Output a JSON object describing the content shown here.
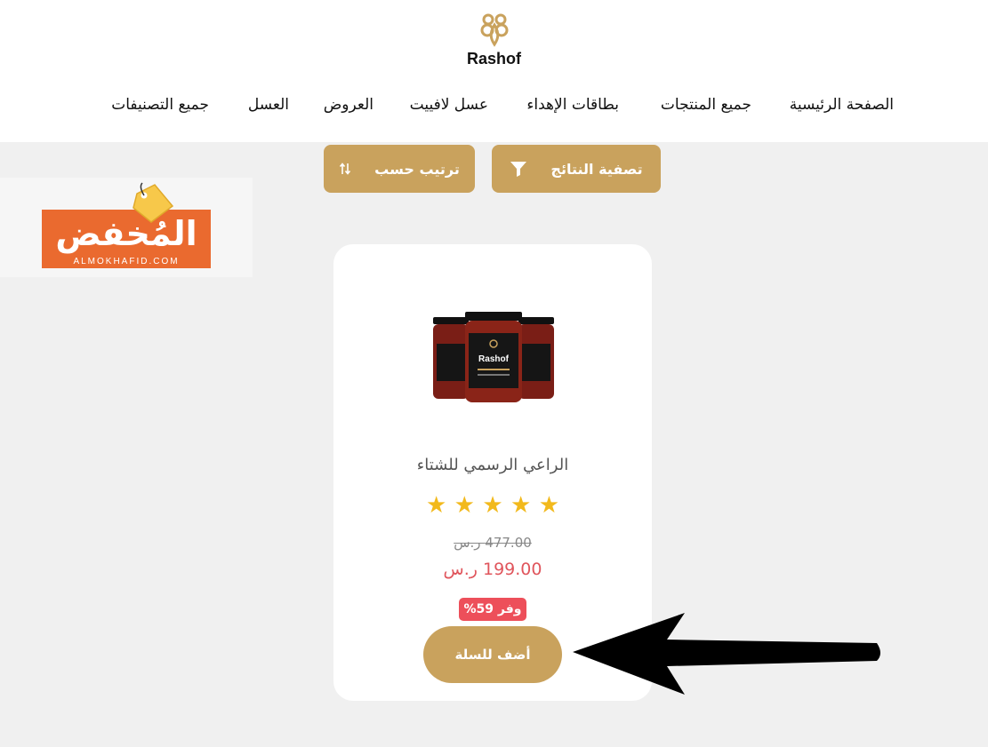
{
  "brand": {
    "name": "Rashof"
  },
  "nav": {
    "items": [
      {
        "label": "الصفحة الرئيسية"
      },
      {
        "label": "جميع المنتجات"
      },
      {
        "label": "بطاقات الإهداء"
      },
      {
        "label": "عسل لافييت"
      },
      {
        "label": "العروض"
      },
      {
        "label": "العسل"
      },
      {
        "label": "جميع التصنيفات"
      }
    ]
  },
  "toolbar": {
    "filter_label": "تصفية النتائج",
    "filter_icon": "filter-icon",
    "sort_label": "ترتيب حسب",
    "sort_icon": "sort-arrows-icon"
  },
  "ad": {
    "title": "المُخفض",
    "subtitle": "ALMOKHAFID.COM",
    "icon": "price-tag-icon"
  },
  "product": {
    "title": "الراعي الرسمي للشتاء",
    "rating": 5,
    "stars": [
      "★",
      "★",
      "★",
      "★",
      "★"
    ],
    "old_price": "477.00 ر.س",
    "new_price": "199.00 ر.س",
    "discount_badge": "وفر 59%",
    "add_to_cart_label": "أضف للسلة",
    "jar_label": "Rashof"
  },
  "colors": {
    "accent": "#c9a25d",
    "price": "#e0555c",
    "badge": "#ed4f5a",
    "star": "#f2b91c",
    "ad_orange": "#ea6a2f",
    "background": "#f0f0f0"
  }
}
